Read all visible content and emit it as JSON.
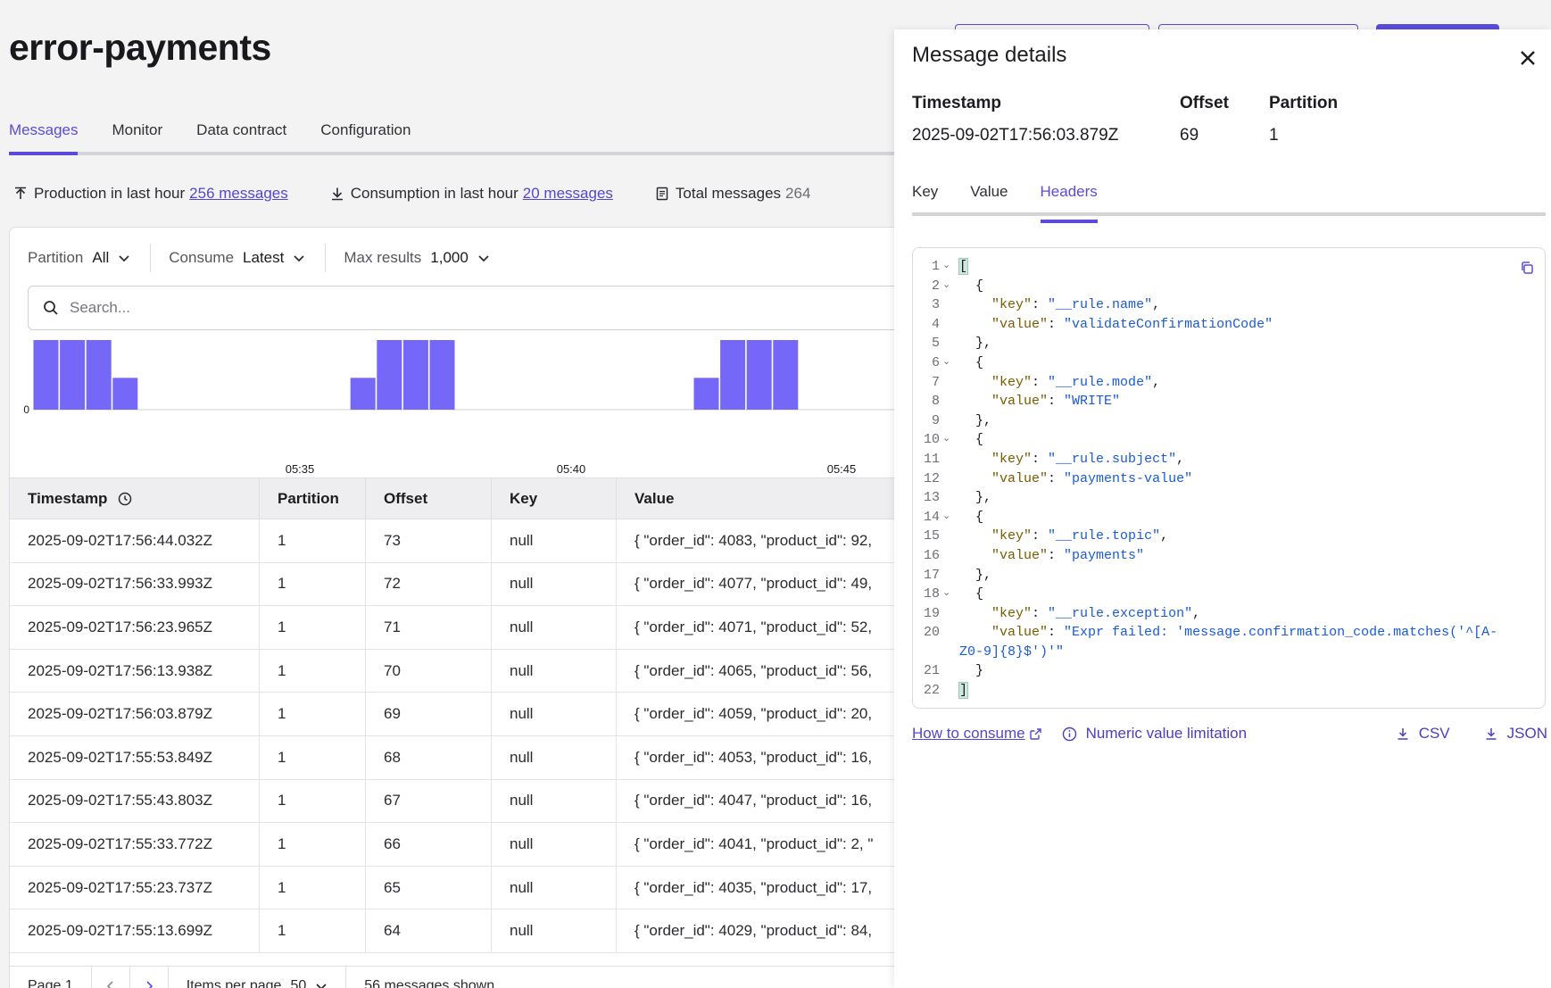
{
  "page": {
    "title": "error-payments"
  },
  "tabs": [
    "Messages",
    "Monitor",
    "Data contract",
    "Configuration"
  ],
  "stats": {
    "production_label": "Production in last hour",
    "production_link": "256 messages",
    "consumption_label": "Consumption in last hour",
    "consumption_link": "20 messages",
    "total_label": "Total messages",
    "total_value": "264"
  },
  "filters": {
    "partition_label": "Partition",
    "partition_value": "All",
    "consume_label": "Consume",
    "consume_value": "Latest",
    "max_label": "Max results",
    "max_value": "1,000"
  },
  "search": {
    "placeholder": "Search..."
  },
  "chart_data": {
    "type": "bar",
    "y_ticks": [
      "0",
      "3"
    ],
    "ylim": [
      0,
      3
    ],
    "x_ticks": [
      "05:35",
      "05:40",
      "05:45"
    ],
    "values": [
      3,
      3,
      3,
      1,
      0,
      0,
      0,
      0,
      0,
      0,
      0,
      0,
      1,
      3,
      3,
      3,
      0,
      0,
      0,
      0,
      0,
      0,
      0,
      0,
      0,
      1,
      3,
      3,
      3
    ],
    "color": "#7567f8"
  },
  "table": {
    "headers": [
      "Timestamp",
      "Partition",
      "Offset",
      "Key",
      "Value"
    ],
    "rows": [
      [
        "2025-09-02T17:56:44.032Z",
        "1",
        "73",
        "null",
        "{ \"order_id\": 4083, \"product_id\": 92,"
      ],
      [
        "2025-09-02T17:56:33.993Z",
        "1",
        "72",
        "null",
        "{ \"order_id\": 4077, \"product_id\": 49,"
      ],
      [
        "2025-09-02T17:56:23.965Z",
        "1",
        "71",
        "null",
        "{ \"order_id\": 4071, \"product_id\": 52,"
      ],
      [
        "2025-09-02T17:56:13.938Z",
        "1",
        "70",
        "null",
        "{ \"order_id\": 4065, \"product_id\": 56,"
      ],
      [
        "2025-09-02T17:56:03.879Z",
        "1",
        "69",
        "null",
        "{ \"order_id\": 4059, \"product_id\": 20,"
      ],
      [
        "2025-09-02T17:55:53.849Z",
        "1",
        "68",
        "null",
        "{ \"order_id\": 4053, \"product_id\": 16,"
      ],
      [
        "2025-09-02T17:55:43.803Z",
        "1",
        "67",
        "null",
        "{ \"order_id\": 4047, \"product_id\": 16,"
      ],
      [
        "2025-09-02T17:55:33.772Z",
        "1",
        "66",
        "null",
        "{ \"order_id\": 4041, \"product_id\": 2, \""
      ],
      [
        "2025-09-02T17:55:23.737Z",
        "1",
        "65",
        "null",
        "{ \"order_id\": 4035, \"product_id\": 17,"
      ],
      [
        "2025-09-02T17:55:13.699Z",
        "1",
        "64",
        "null",
        "{ \"order_id\": 4029, \"product_id\": 84,"
      ]
    ]
  },
  "pager": {
    "page": "Page 1",
    "items_label": "Items per page",
    "items_value": "50",
    "shown": "56 messages shown"
  },
  "drawer": {
    "title": "Message details",
    "meta": {
      "timestamp_label": "Timestamp",
      "timestamp_value": "2025-09-02T17:56:03.879Z",
      "offset_label": "Offset",
      "offset_value": "69",
      "partition_label": "Partition",
      "partition_value": "1"
    },
    "tabs": [
      "Key",
      "Value",
      "Headers"
    ],
    "active_tab": "Headers",
    "code_lines": [
      {
        "n": "1",
        "fold": true,
        "t": "["
      },
      {
        "n": "2",
        "fold": true,
        "t": "  {"
      },
      {
        "n": "3",
        "fold": false,
        "k": "\"key\"",
        "v": "\"__rule.name\"",
        "end": ","
      },
      {
        "n": "4",
        "fold": false,
        "k": "\"value\"",
        "v": "\"validateConfirmationCode\"",
        "end": ""
      },
      {
        "n": "5",
        "fold": false,
        "t": "  },"
      },
      {
        "n": "6",
        "fold": true,
        "t": "  {"
      },
      {
        "n": "7",
        "fold": false,
        "k": "\"key\"",
        "v": "\"__rule.mode\"",
        "end": ","
      },
      {
        "n": "8",
        "fold": false,
        "k": "\"value\"",
        "v": "\"WRITE\"",
        "end": ""
      },
      {
        "n": "9",
        "fold": false,
        "t": "  },"
      },
      {
        "n": "10",
        "fold": true,
        "t": "  {"
      },
      {
        "n": "11",
        "fold": false,
        "k": "\"key\"",
        "v": "\"__rule.subject\"",
        "end": ","
      },
      {
        "n": "12",
        "fold": false,
        "k": "\"value\"",
        "v": "\"payments-value\"",
        "end": ""
      },
      {
        "n": "13",
        "fold": false,
        "t": "  },"
      },
      {
        "n": "14",
        "fold": true,
        "t": "  {"
      },
      {
        "n": "15",
        "fold": false,
        "k": "\"key\"",
        "v": "\"__rule.topic\"",
        "end": ","
      },
      {
        "n": "16",
        "fold": false,
        "k": "\"value\"",
        "v": "\"payments\"",
        "end": ""
      },
      {
        "n": "17",
        "fold": false,
        "t": "  },"
      },
      {
        "n": "18",
        "fold": true,
        "t": "  {"
      },
      {
        "n": "19",
        "fold": false,
        "k": "\"key\"",
        "v": "\"__rule.exception\"",
        "end": ","
      },
      {
        "n": "20",
        "fold": false,
        "k": "\"value\"",
        "v": "\"Expr failed: 'message.confirmation_code.matches('^[A-",
        "end": ""
      },
      {
        "n": "",
        "fold": false,
        "cont": "Z0-9]{8}$')'\""
      },
      {
        "n": "21",
        "fold": false,
        "t": "  }"
      },
      {
        "n": "22",
        "fold": false,
        "t": "]"
      }
    ],
    "footer": {
      "how_to": "How to consume",
      "numeric": "Numeric value limitation",
      "csv": "CSV",
      "json": "JSON"
    }
  }
}
